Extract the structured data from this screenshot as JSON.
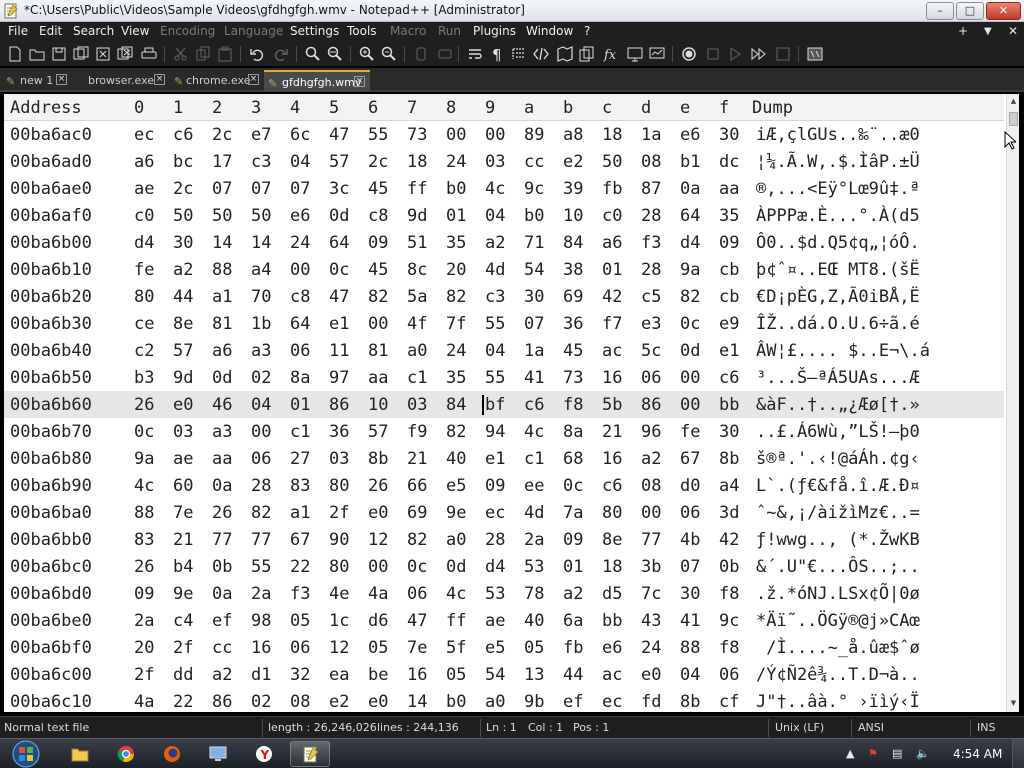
{
  "window": {
    "title": "*C:\\Users\\Public\\Videos\\Sample Videos\\gfdhgfgh.wmv - Notepad++ [Administrator]",
    "minimize": "–",
    "maximize": "□",
    "close": "✕"
  },
  "menu": [
    "File",
    "Edit",
    "Search",
    "View",
    "Encoding",
    "Language",
    "Settings",
    "Tools",
    "Macro",
    "Run",
    "Plugins",
    "Window",
    "?"
  ],
  "menu_right": {
    "plus": "+",
    "down": "▼",
    "close": "✕"
  },
  "tabs": [
    {
      "label": "new 1",
      "icon": "pencil-icon",
      "close": "×"
    },
    {
      "label": "browser.exe",
      "icon": "",
      "close": "×"
    },
    {
      "label": "chrome.exe",
      "icon": "pencil-icon",
      "close": "×"
    },
    {
      "label": "gfdhgfgh.wmv",
      "icon": "pencil-icon",
      "close": "×"
    }
  ],
  "hex": {
    "header": [
      "Address",
      "0",
      "1",
      "2",
      "3",
      "4",
      "5",
      "6",
      "7",
      "8",
      "9",
      "a",
      "b",
      "c",
      "d",
      "e",
      "f",
      "Dump"
    ],
    "rows": [
      {
        "addr": "00ba6ac0",
        "bytes": [
          "ec",
          "c6",
          "2c",
          "e7",
          "6c",
          "47",
          "55",
          "73",
          "00",
          "00",
          "89",
          "a8",
          "18",
          "1a",
          "e6",
          "30"
        ],
        "dump": "iÆ,çlGUs..‰¨..æ0"
      },
      {
        "addr": "00ba6ad0",
        "bytes": [
          "a6",
          "bc",
          "17",
          "c3",
          "04",
          "57",
          "2c",
          "18",
          "24",
          "03",
          "cc",
          "e2",
          "50",
          "08",
          "b1",
          "dc"
        ],
        "dump": "¦¼.Ã.W,.$.ÌâP.±Ü"
      },
      {
        "addr": "00ba6ae0",
        "bytes": [
          "ae",
          "2c",
          "07",
          "07",
          "07",
          "3c",
          "45",
          "ff",
          "b0",
          "4c",
          "9c",
          "39",
          "fb",
          "87",
          "0a",
          "aa"
        ],
        "dump": "®,...<Eÿ°Lœ9û‡.ª"
      },
      {
        "addr": "00ba6af0",
        "bytes": [
          "c0",
          "50",
          "50",
          "50",
          "e6",
          "0d",
          "c8",
          "9d",
          "01",
          "04",
          "b0",
          "10",
          "c0",
          "28",
          "64",
          "35"
        ],
        "dump": "ÀPPPæ.È...°.À(d5"
      },
      {
        "addr": "00ba6b00",
        "bytes": [
          "d4",
          "30",
          "14",
          "14",
          "24",
          "64",
          "09",
          "51",
          "35",
          "a2",
          "71",
          "84",
          "a6",
          "f3",
          "d4",
          "09"
        ],
        "dump": "Ô0..$d.Q5¢q„¦óÔ."
      },
      {
        "addr": "00ba6b10",
        "bytes": [
          "fe",
          "a2",
          "88",
          "a4",
          "00",
          "0c",
          "45",
          "8c",
          "20",
          "4d",
          "54",
          "38",
          "01",
          "28",
          "9a",
          "cb"
        ],
        "dump": "þ¢ˆ¤..EŒ MT8.(šË"
      },
      {
        "addr": "00ba6b20",
        "bytes": [
          "80",
          "44",
          "a1",
          "70",
          "c8",
          "47",
          "82",
          "5a",
          "82",
          "c3",
          "30",
          "69",
          "42",
          "c5",
          "82",
          "cb"
        ],
        "dump": "€D¡pÈG‚Z‚Ã0iBÅ‚Ë"
      },
      {
        "addr": "00ba6b30",
        "bytes": [
          "ce",
          "8e",
          "81",
          "1b",
          "64",
          "e1",
          "00",
          "4f",
          "7f",
          "55",
          "07",
          "36",
          "f7",
          "e3",
          "0c",
          "e9"
        ],
        "dump": "ÎŽ..dá.O.U.6÷ã.é"
      },
      {
        "addr": "00ba6b40",
        "bytes": [
          "c2",
          "57",
          "a6",
          "a3",
          "06",
          "11",
          "81",
          "a0",
          "24",
          "04",
          "1a",
          "45",
          "ac",
          "5c",
          "0d",
          "e1"
        ],
        "dump": "ÂW¦£.... $..E¬\\.á"
      },
      {
        "addr": "00ba6b50",
        "bytes": [
          "b3",
          "9d",
          "0d",
          "02",
          "8a",
          "97",
          "aa",
          "c1",
          "35",
          "55",
          "41",
          "73",
          "16",
          "06",
          "00",
          "c6"
        ],
        "dump": "³...Š—ªÁ5UAs...Æ"
      },
      {
        "addr": "00ba6b60",
        "bytes": [
          "26",
          "e0",
          "46",
          "04",
          "01",
          "86",
          "10",
          "03",
          "84",
          "bf",
          "c6",
          "f8",
          "5b",
          "86",
          "00",
          "bb"
        ],
        "dump": "&àF..†..„¿Æø[†.»"
      },
      {
        "addr": "00ba6b70",
        "bytes": [
          "0c",
          "03",
          "a3",
          "00",
          "c1",
          "36",
          "57",
          "f9",
          "82",
          "94",
          "4c",
          "8a",
          "21",
          "96",
          "fe",
          "30"
        ],
        "dump": "..£.Á6Wù‚”LŠ!–þ0"
      },
      {
        "addr": "00ba6b80",
        "bytes": [
          "9a",
          "ae",
          "aa",
          "06",
          "27",
          "03",
          "8b",
          "21",
          "40",
          "e1",
          "c1",
          "68",
          "16",
          "a2",
          "67",
          "8b"
        ],
        "dump": "š®ª.'.‹!@áÁh.¢g‹"
      },
      {
        "addr": "00ba6b90",
        "bytes": [
          "4c",
          "60",
          "0a",
          "28",
          "83",
          "80",
          "26",
          "66",
          "e5",
          "09",
          "ee",
          "0c",
          "c6",
          "08",
          "d0",
          "a4"
        ],
        "dump": "L`.(ƒ€&få.î.Æ.Ð¤"
      },
      {
        "addr": "00ba6ba0",
        "bytes": [
          "88",
          "7e",
          "26",
          "82",
          "a1",
          "2f",
          "e0",
          "69",
          "9e",
          "ec",
          "4d",
          "7a",
          "80",
          "00",
          "06",
          "3d"
        ],
        "dump": "ˆ~&‚¡/àižìMz€..="
      },
      {
        "addr": "00ba6bb0",
        "bytes": [
          "83",
          "21",
          "77",
          "77",
          "67",
          "90",
          "12",
          "82",
          "a0",
          "28",
          "2a",
          "09",
          "8e",
          "77",
          "4b",
          "42"
        ],
        "dump": "ƒ!wwg..‚ (*.ŽwKB"
      },
      {
        "addr": "00ba6bc0",
        "bytes": [
          "26",
          "b4",
          "0b",
          "55",
          "22",
          "80",
          "00",
          "0c",
          "0d",
          "d4",
          "53",
          "01",
          "18",
          "3b",
          "07",
          "0b"
        ],
        "dump": "&´.U\"€...ÔS..;.."
      },
      {
        "addr": "00ba6bd0",
        "bytes": [
          "09",
          "9e",
          "0a",
          "2a",
          "f3",
          "4e",
          "4a",
          "06",
          "4c",
          "53",
          "78",
          "a2",
          "d5",
          "7c",
          "30",
          "f8"
        ],
        "dump": ".ž.*óNJ.LSx¢Õ|0ø"
      },
      {
        "addr": "00ba6be0",
        "bytes": [
          "2a",
          "c4",
          "ef",
          "98",
          "05",
          "1c",
          "d6",
          "47",
          "ff",
          "ae",
          "40",
          "6a",
          "bb",
          "43",
          "41",
          "9c"
        ],
        "dump": "*Äï˜..ÖGÿ®@j»CAœ"
      },
      {
        "addr": "00ba6bf0",
        "bytes": [
          "20",
          "2f",
          "cc",
          "16",
          "06",
          "12",
          "05",
          "7e",
          "5f",
          "e5",
          "05",
          "fb",
          "e6",
          "24",
          "88",
          "f8"
        ],
        "dump": " /Ì....~_å.ûæ$ˆø"
      },
      {
        "addr": "00ba6c00",
        "bytes": [
          "2f",
          "dd",
          "a2",
          "d1",
          "32",
          "ea",
          "be",
          "16",
          "05",
          "54",
          "13",
          "44",
          "ac",
          "e0",
          "04",
          "06"
        ],
        "dump": "/Ý¢Ñ2ê¾..T.D¬à.."
      },
      {
        "addr": "00ba6c10",
        "bytes": [
          "4a",
          "22",
          "86",
          "02",
          "08",
          "e2",
          "e0",
          "14",
          "b0",
          "a0",
          "9b",
          "ef",
          "ec",
          "fd",
          "8b",
          "cf"
        ],
        "dump": "J\"†..âà.° ›ïìý‹Ï"
      }
    ],
    "highlight_row": 10,
    "caret_col": 9
  },
  "status": {
    "type": "Normal text file",
    "length": "length : 26,246,026",
    "lines": "lines : 244,136",
    "ln": "Ln : 1",
    "col": "Col : 1",
    "pos": "Pos : 1",
    "eol": "Unix (LF)",
    "encoding": "ANSI",
    "ins": "INS"
  },
  "taskbar": {
    "clock": "4:54 AM",
    "apps": [
      "start-orb-icon",
      "file-explorer-icon",
      "chrome-icon",
      "firefox-icon",
      "remote-desktop-icon",
      "yandex-icon",
      "notepadpp-icon"
    ],
    "tray": [
      "arrow-up-icon",
      "flag-icon",
      "network-icon",
      "volume-icon"
    ]
  }
}
